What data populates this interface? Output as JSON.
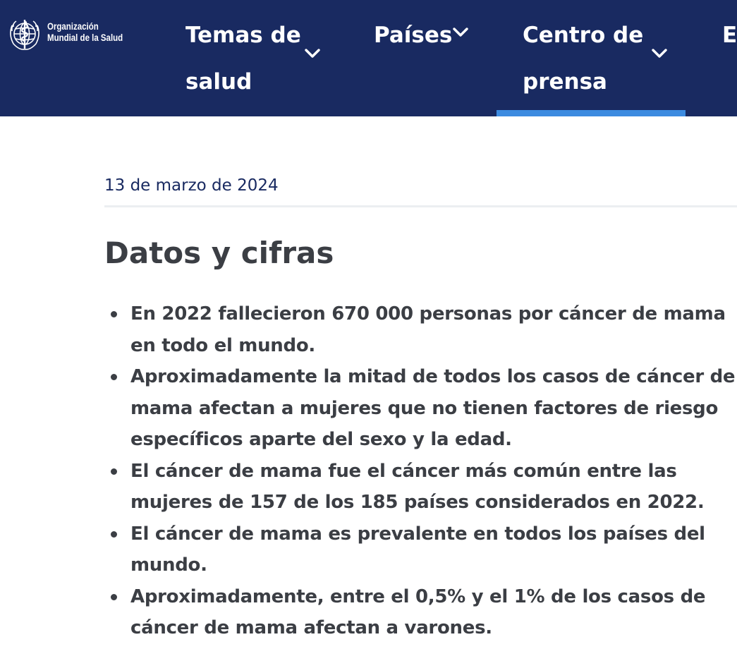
{
  "header": {
    "logo_line1": "Organización",
    "logo_line2": "Mundial de la Salud",
    "nav": [
      {
        "label": "Temas de salud",
        "icon": "chevron-down-icon"
      },
      {
        "label": "Países",
        "icon": "chevron-down-icon"
      },
      {
        "label": "Centro de prensa",
        "icon": "chevron-down-icon"
      },
      {
        "label": "E"
      }
    ],
    "active_item": "Centro de prensa"
  },
  "article": {
    "date": "13 de marzo de 2024",
    "heading": "Datos y cifras",
    "facts": [
      "En 2022 fallecieron 670 000 personas por cáncer de mama en todo el mundo.",
      "Aproximadamente la mitad de todos los casos de cáncer de mama afectan a mujeres que no tienen factores de riesgo específicos aparte del sexo y la edad.",
      "El cáncer de mama fue el cáncer más común entre las mujeres de 157 de los 185 países considerados en 2022.",
      "El cáncer de mama es prevalente en todos los países del mundo.",
      "Aproximadamente, entre el 0,5% y el 1% de los casos de cáncer de mama afectan a varones."
    ]
  },
  "colors": {
    "nav_background": "#192a61",
    "active_indicator": "#3c8be0",
    "body_text": "#3b3e44",
    "date_text": "#192a61"
  }
}
